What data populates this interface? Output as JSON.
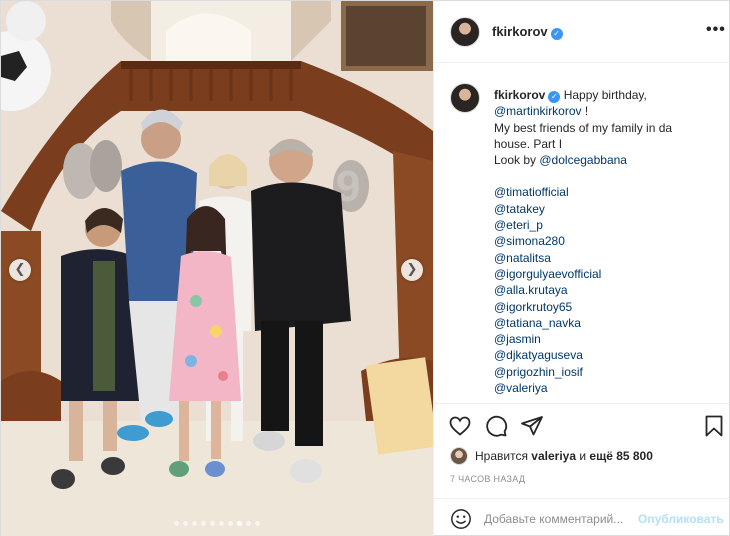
{
  "post": {
    "author": "fkirkorov",
    "verified": true,
    "more_icon": "more-horizontal-icon"
  },
  "caption": {
    "author": "fkirkorov",
    "line1": "Happy birthday,",
    "line2_mention": "@martinkirkorov",
    "line2_rest": " !",
    "line3": "My best friends of my family in da",
    "line4": "house. Part I",
    "line5_prefix": "Look by ",
    "line5_mention": "@dolcegabbana",
    "mentions": [
      "@timatiofficial",
      "@tatakey",
      "@eteri_p",
      "@simona280",
      "@natalitsa",
      "@igorgulyaevofficial",
      "@alla.krutaya",
      "@igorkrutoy65",
      "@tatiana_navka",
      "@jasmin",
      "@djkatyaguseva",
      "@prigozhin_iosif",
      "@valeriya"
    ]
  },
  "carousel": {
    "prev_icon": "chevron-left-icon",
    "next_icon": "chevron-right-icon",
    "slide_count": 10,
    "active_index": 7
  },
  "actions": {
    "like_icon": "heart-icon",
    "comment_icon": "comment-icon",
    "share_icon": "paper-plane-icon",
    "save_icon": "bookmark-icon"
  },
  "likes": {
    "prefix": "Нравится ",
    "user": "valeriya",
    "middle": " и ",
    "others": "ещё 85 800"
  },
  "timestamp": "7 ЧАСОВ НАЗАД",
  "comment": {
    "placeholder": "Добавьте комментарий...",
    "publish_label": "Опубликовать",
    "emoji_icon": "smiley-icon"
  },
  "colors": {
    "text": "#262626",
    "mention": "#00376b",
    "muted": "#8e8e8e",
    "publish_disabled": "#b2dffc",
    "verified": "#3897f0"
  }
}
